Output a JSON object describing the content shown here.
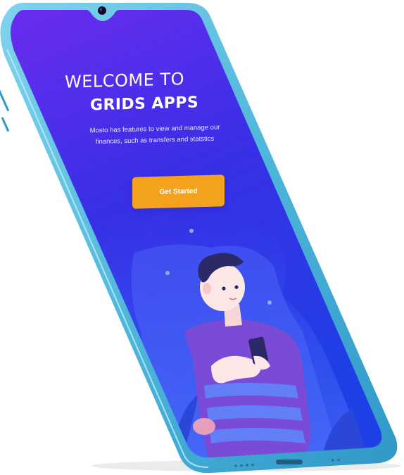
{
  "welcome": {
    "title_line1": "WELCOME TO",
    "title_line2": "GRIDS APPS",
    "description": "Mosto has features to view and manage our finances, such as transfers and statstics",
    "cta_label": "Get Started"
  },
  "colors": {
    "screen_top": "#6a2cf0",
    "screen_bottom": "#1f3fe6",
    "button": "#f4a21d",
    "phone_frame": "#5ec3e3"
  },
  "icons": {
    "camera": "front-camera-icon",
    "speaker": "speaker-grille-icon"
  }
}
